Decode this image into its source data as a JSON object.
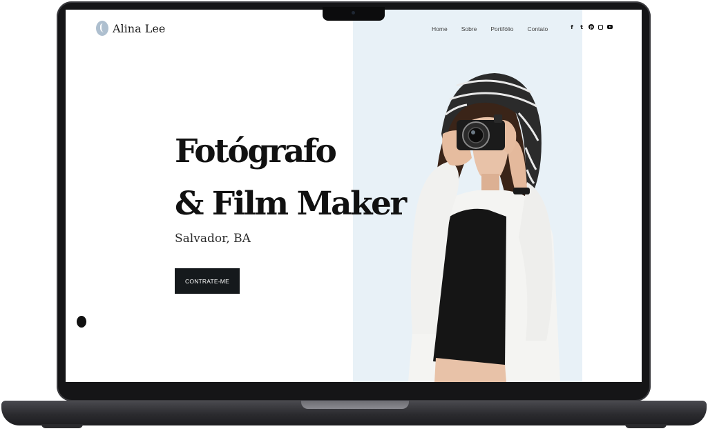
{
  "site": {
    "logo_text": "Alina Lee",
    "nav": [
      "Home",
      "Sobre",
      "Portifólio",
      "Contato"
    ],
    "social_icons": [
      "facebook-icon",
      "twitter-icon",
      "pinterest-icon",
      "instagram-icon",
      "youtube-icon"
    ],
    "headline_line1": "Fotógrafo",
    "headline_line2": "& Film Maker",
    "subtitle": "Salvador, BA",
    "cta_label": "CONTRATE-ME"
  },
  "colors": {
    "accent_dark": "#15191c",
    "photo_background": "#e8f1f7",
    "laptop_frame": "#151517"
  }
}
